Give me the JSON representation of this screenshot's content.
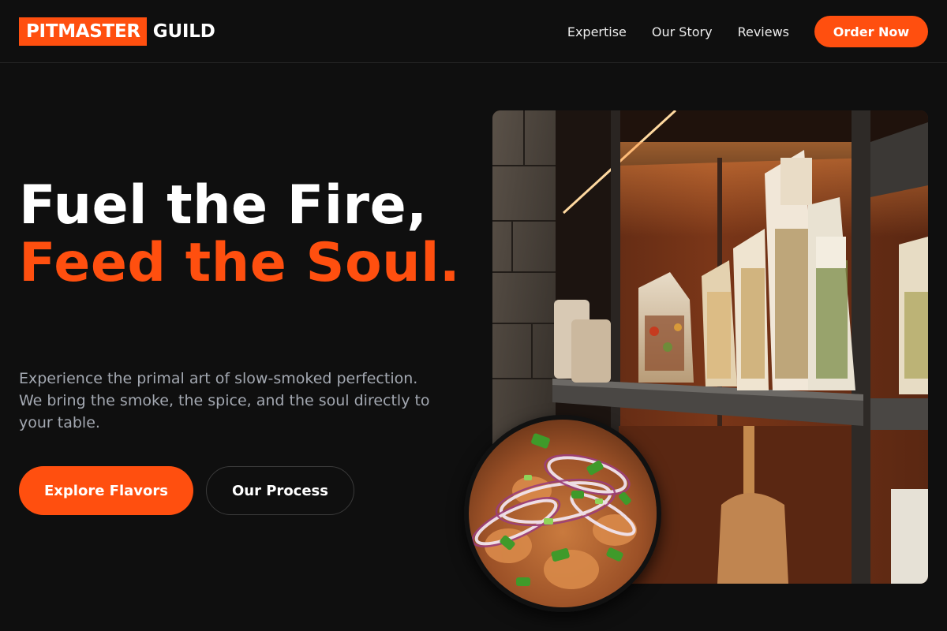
{
  "brand": {
    "name_highlight": "PITMASTER",
    "name_rest": "GUILD",
    "accent_color": "#ff4f0f"
  },
  "nav": {
    "links": [
      "Expertise",
      "Our Story",
      "Reviews"
    ],
    "cta_label": "Order Now"
  },
  "hero": {
    "headline_line1": "Fuel the Fire,",
    "headline_line2": "Feed the Soul.",
    "description": "Experience the primal art of slow-smoked perfection. We bring the smoke, the spice, and the soul directly to your table.",
    "primary_button": "Explore Flavors",
    "secondary_button": "Our Process"
  },
  "images": {
    "main_photo": "shop-shelves-with-pasta-bags",
    "circle_photo": "dish-with-onions-and-scallions"
  }
}
